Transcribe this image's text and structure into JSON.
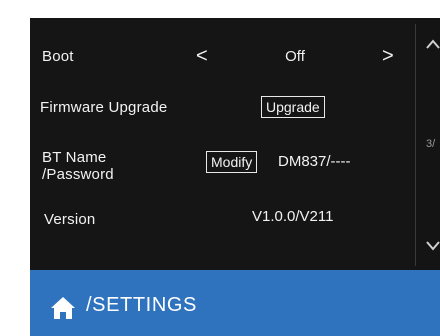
{
  "settings": {
    "rows": [
      {
        "label": "Boot",
        "value": "Off"
      },
      {
        "label": "Firmware Upgrade",
        "button": "Upgrade"
      },
      {
        "label_line1": "BT Name",
        "label_line2": "/Password",
        "button": "Modify",
        "value": "DM837/----"
      },
      {
        "label": "Version",
        "value": "V1.0.0/V211"
      }
    ],
    "prev_arrow": "<",
    "next_arrow": ">"
  },
  "scroll": {
    "up_icon": "chevron-up-icon",
    "down_icon": "chevron-down-icon",
    "page_partial": "3/"
  },
  "footer": {
    "breadcrumb": "/SETTINGS",
    "home_icon": "home-icon",
    "color": "#2f73bf"
  }
}
